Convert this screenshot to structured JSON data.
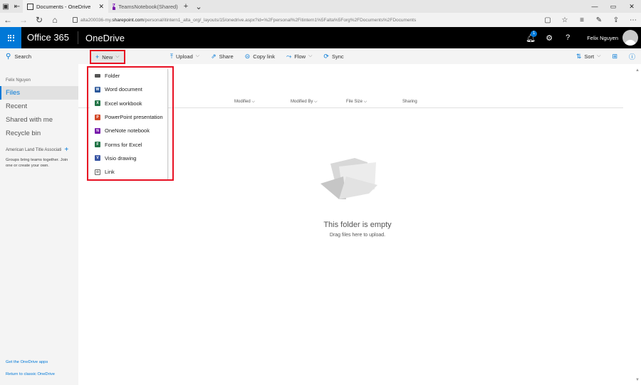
{
  "browser": {
    "tabs": [
      {
        "title": "Documents - OneDrive",
        "active": true
      },
      {
        "title": "TeamsNotebook(Shared)",
        "active": false
      }
    ],
    "url_prefix": "alta200036-my.",
    "url_domain": "sharepoint.com",
    "url_rest": "/personal/itintern1_alta_org/_layouts/15/onedrive.aspx?id=%2Fpersonal%2Fitintern1%5Falta%5Forg%2FDocuments%2FDocuments"
  },
  "suite": {
    "brand": "Office 365",
    "app": "OneDrive",
    "notification_count": "1",
    "help": "?",
    "user": "Felix Nguyen"
  },
  "leftnav": {
    "search": "Search",
    "user": "Felix Nguyen",
    "items": [
      {
        "label": "Files",
        "selected": true
      },
      {
        "label": "Recent",
        "selected": false
      },
      {
        "label": "Shared with me",
        "selected": false
      },
      {
        "label": "Recycle bin",
        "selected": false
      }
    ],
    "group": "American Land Title Associati",
    "group_hint": "Groups bring teams together. Join one or create your own.",
    "footer_apps": "Get the OneDrive apps",
    "footer_classic": "Return to classic OneDrive"
  },
  "commands": {
    "new": "New",
    "upload": "Upload",
    "share": "Share",
    "copy_link": "Copy link",
    "flow": "Flow",
    "sync": "Sync",
    "sort": "Sort"
  },
  "columns": {
    "modified": "Modified",
    "modified_by": "Modified By",
    "file_size": "File Size",
    "sharing": "Sharing"
  },
  "new_menu": [
    {
      "label": "Folder",
      "icon": "folder-icon",
      "color": "#555555"
    },
    {
      "label": "Word document",
      "icon": "word-icon",
      "color": "#2b579a"
    },
    {
      "label": "Excel workbook",
      "icon": "excel-icon",
      "color": "#217346"
    },
    {
      "label": "PowerPoint presentation",
      "icon": "powerpoint-icon",
      "color": "#d24726"
    },
    {
      "label": "OneNote notebook",
      "icon": "onenote-icon",
      "color": "#7719aa"
    },
    {
      "label": "Forms for Excel",
      "icon": "forms-icon",
      "color": "#217346"
    },
    {
      "label": "Visio drawing",
      "icon": "visio-icon",
      "color": "#3955a3"
    },
    {
      "label": "Link",
      "icon": "link-icon",
      "color": "#666666"
    }
  ],
  "empty": {
    "title": "This folder is empty",
    "subtitle": "Drag files here to upload."
  },
  "colors": {
    "accent": "#0078d7",
    "highlight": "#e81123",
    "suitebar": "#000000"
  }
}
